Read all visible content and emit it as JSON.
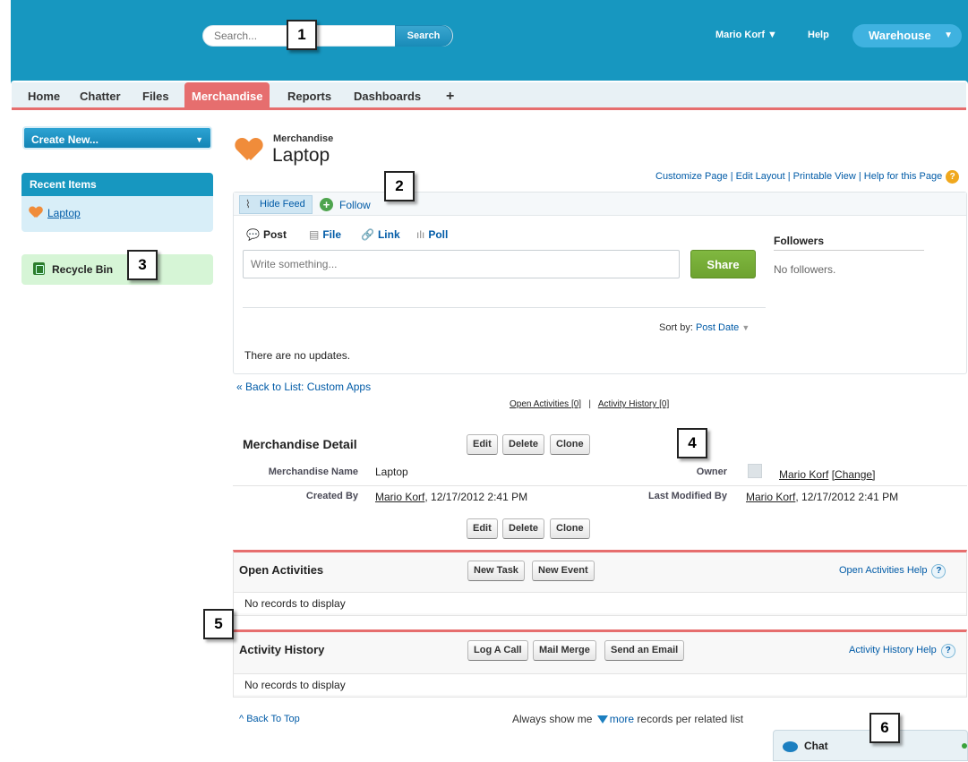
{
  "header": {
    "search_placeholder": "Search...",
    "search_button": "Search",
    "user_name": "Mario Korf ▼",
    "help": "Help",
    "app_name": "Warehouse",
    "app_arrow": "▼"
  },
  "tabs": [
    "Home",
    "Chatter",
    "Files",
    "Merchandise",
    "Reports",
    "Dashboards",
    "+"
  ],
  "sidebar": {
    "create_new": "Create New...",
    "create_arrow": "▼",
    "recent_items_title": "Recent Items",
    "recent_items": [
      "Laptop"
    ],
    "recycle_bin": "Recycle Bin"
  },
  "callouts": [
    "1",
    "2",
    "3",
    "4",
    "5",
    "6"
  ],
  "page": {
    "object_type": "Merchandise",
    "record_name": "Laptop",
    "page_links": "Customize Page | Edit Layout | Printable View | Help for this Page",
    "help_icon": "?"
  },
  "feed": {
    "hide_feed": "Hide Feed",
    "follow_icon": "+",
    "follow": "Follow",
    "publisher_tabs": [
      {
        "icon": "💬",
        "label": "Post"
      },
      {
        "icon": "▤",
        "label": "File"
      },
      {
        "icon": "🔗",
        "label": "Link"
      },
      {
        "icon": "ılı",
        "label": "Poll"
      }
    ],
    "post_placeholder": "Write something...",
    "share": "Share",
    "followers_title": "Followers",
    "no_followers": "No followers.",
    "sort_label": "Sort by:",
    "sort_value": "Post Date",
    "sort_arrow": "▼",
    "no_updates": "There are no updates."
  },
  "nav": {
    "back_to_list": "« Back to List: Custom Apps",
    "open_activities_link": "Open Activities",
    "open_activities_count": "[0]",
    "separator": "|",
    "activity_history_link": "Activity History",
    "activity_history_count": "[0]"
  },
  "detail": {
    "title": "Merchandise Detail",
    "buttons": [
      "Edit",
      "Delete",
      "Clone"
    ],
    "merchandise_name_label": "Merchandise Name",
    "merchandise_name_value": "Laptop",
    "owner_label": "Owner",
    "owner_value": "Mario Korf",
    "owner_change": "[Change]",
    "created_by_label": "Created By",
    "created_by_user": "Mario Korf",
    "created_by_date": ", 12/17/2012 2:41 PM",
    "last_modified_label": "Last Modified By",
    "last_modified_user": "Mario Korf",
    "last_modified_date": ", 12/17/2012 2:41 PM"
  },
  "open_activities": {
    "title": "Open Activities",
    "buttons": [
      "New Task",
      "New Event"
    ],
    "help": "Open Activities Help",
    "help_icon": "?",
    "empty": "No records to display"
  },
  "activity_history": {
    "title": "Activity History",
    "buttons": [
      "Log A Call",
      "Mail Merge",
      "Send an Email"
    ],
    "help": "Activity History Help",
    "help_icon": "?",
    "empty": "No records to display"
  },
  "footer": {
    "back_to_top": "^ Back To Top",
    "always_show_prefix": "Always show me",
    "more": "more",
    "always_show_suffix": "records per related list"
  },
  "chat": {
    "label": "Chat"
  }
}
